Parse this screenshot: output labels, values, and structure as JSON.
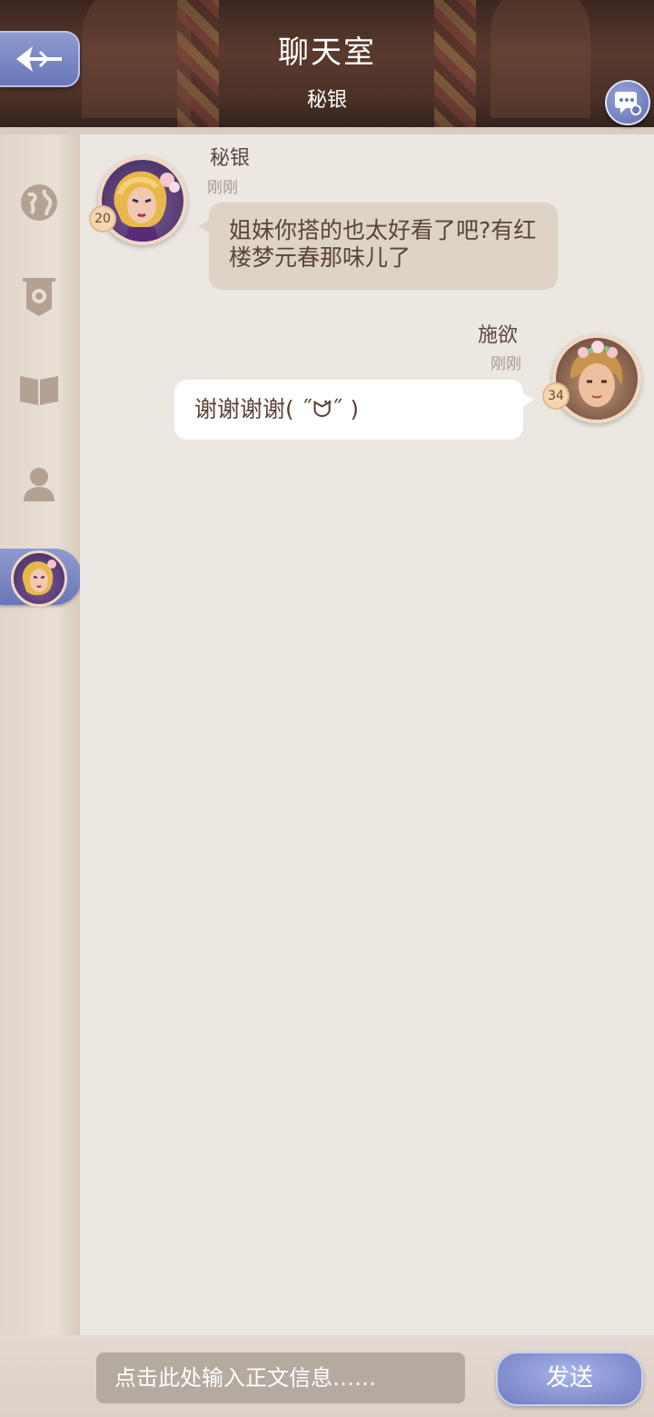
{
  "header": {
    "title": "聊天室",
    "subtitle": "秘银"
  },
  "sidebar": {
    "items": [
      {
        "icon": "globe-icon"
      },
      {
        "icon": "rose-banner-icon"
      },
      {
        "icon": "book-icon"
      },
      {
        "icon": "person-icon"
      },
      {
        "icon": "avatar-contact-icon",
        "active": true
      }
    ]
  },
  "messages": [
    {
      "side": "left",
      "name": "秘银",
      "time": "刚刚",
      "level": "20",
      "text": "姐妹你搭的也太好看了吧?有红楼梦元春那味儿了"
    },
    {
      "side": "right",
      "name": "施欲",
      "time": "刚刚",
      "level": "34",
      "text": "谢谢谢谢( ˝ᗢ̈˝ )"
    }
  ],
  "composer": {
    "placeholder": "点击此处输入正文信息……",
    "send_label": "发送"
  },
  "colors": {
    "accent": "#7b87c6",
    "header_bg": "#4a3028",
    "chat_bg": "#ede7e1",
    "bubble_received": "#ddd3c7",
    "bubble_sent": "#ffffff"
  }
}
